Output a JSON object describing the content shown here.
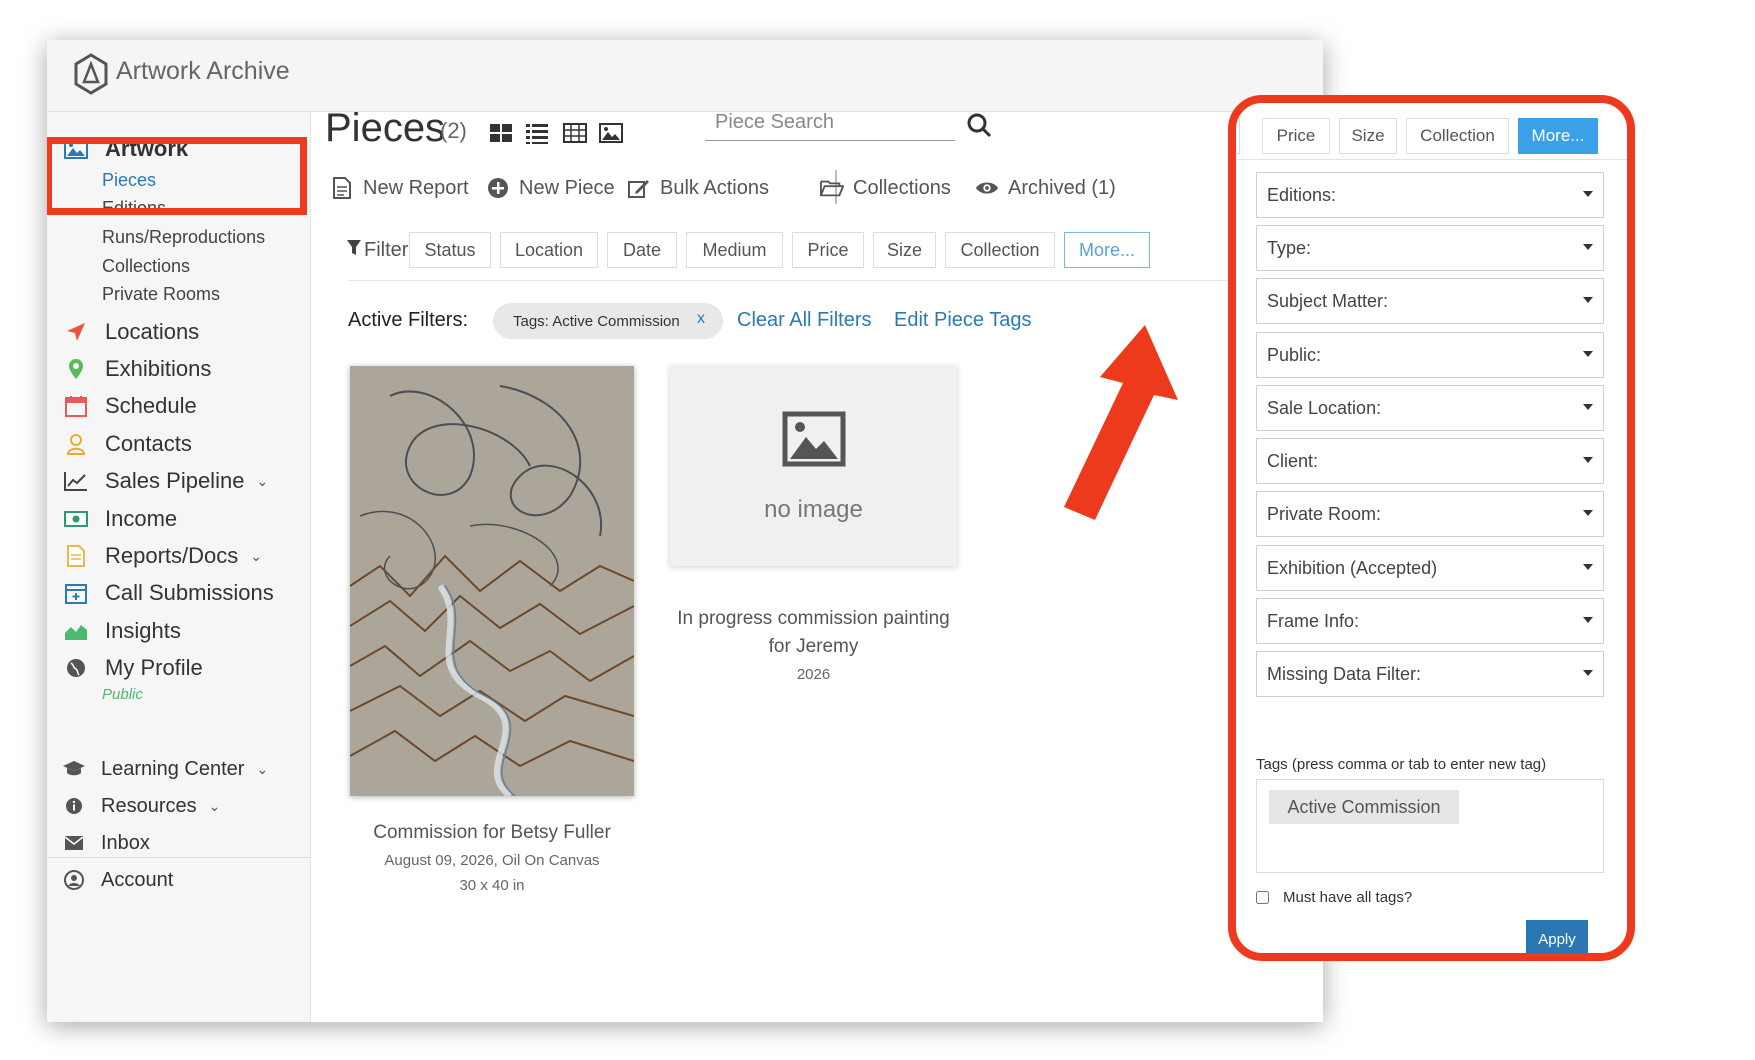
{
  "app": {
    "title": "Artwork Archive"
  },
  "sidebar": {
    "artwork": "Artwork",
    "sub": [
      "Pieces",
      "Editions",
      "Runs/Reproductions",
      "Collections",
      "Private Rooms"
    ],
    "items": [
      "Locations",
      "Exhibitions",
      "Schedule",
      "Contacts",
      "Sales Pipeline",
      "Income",
      "Reports/Docs",
      "Call Submissions",
      "Insights",
      "My Profile"
    ],
    "profile_status": "Public",
    "bottom": [
      "Learning Center",
      "Resources",
      "Inbox",
      "Account"
    ]
  },
  "main": {
    "title": "Pieces",
    "count": "(2)",
    "search_placeholder": "Piece Search",
    "actions": [
      "New Report",
      "New Piece",
      "Bulk Actions",
      "Collections",
      "Archived (1)"
    ],
    "filter_label": "Filter",
    "filters": [
      "Status",
      "Location",
      "Date",
      "Medium",
      "Price",
      "Size",
      "Collection",
      "More..."
    ],
    "active_filters_label": "Active Filters:",
    "active_tag": "Tags: Active Commission",
    "active_tag_remove": "x",
    "clear_filters": "Clear All Filters",
    "edit_tags": "Edit Piece Tags"
  },
  "cards": [
    {
      "title": "Commission for Betsy Fuller",
      "meta1": "August 09, 2026, Oil On Canvas",
      "meta2": "30 x 40 in"
    },
    {
      "title_line1": "In progress commission painting",
      "title_line2": "for Jeremy",
      "meta1": "2026",
      "placeholder": "no image"
    }
  ],
  "panel": {
    "tabs": [
      "Price",
      "Size",
      "Collection",
      "More..."
    ],
    "dropdowns": [
      "Editions:",
      "Type:",
      "Subject Matter:",
      "Public:",
      "Sale Location:",
      "Client:",
      "Private Room:",
      "Exhibition (Accepted)",
      "Frame Info:",
      "Missing Data Filter:"
    ],
    "tags_label": "Tags (press comma or tab to enter new tag)",
    "tag_value": "Active Commission",
    "must_have": "Must have all tags?",
    "apply": "Apply"
  },
  "colors": {
    "highlight": "#ee3a1c",
    "link": "#2a7ab8",
    "accent": "#3aa0e8",
    "apply": "#2a77b3"
  }
}
